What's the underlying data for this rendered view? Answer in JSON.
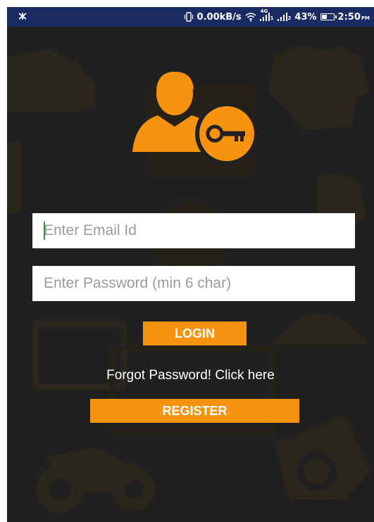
{
  "status_bar": {
    "network_speed": "0.00kB/s",
    "network_superscript": "4G",
    "signal_sub_1": "1",
    "signal_sub_2": "2",
    "battery_percent": "43%",
    "time": "2:50",
    "time_suffix": "PM"
  },
  "login_form": {
    "email_placeholder": "Enter Email Id",
    "email_value": "",
    "password_placeholder": "Enter Password (min 6 char)",
    "password_value": "",
    "login_label": "LOGIN",
    "forgot_label": "Forgot Password! Click here",
    "register_label": "REGISTER"
  },
  "colors": {
    "background": "#202020",
    "status_bar": "#1a2a63",
    "accent": "#f7930f",
    "text_on_dark": "#ffffff",
    "input_bg": "#ffffff",
    "cursor": "#2e9b4f"
  },
  "icons": {
    "logo": "user-key-icon",
    "status_left": "notification-icon",
    "vibrate": "vibrate-icon",
    "wifi": "wifi-icon",
    "signal": "signal-icon",
    "battery": "battery-icon"
  }
}
